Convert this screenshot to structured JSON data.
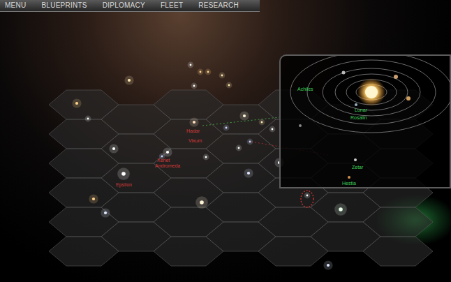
{
  "menu_bar": {
    "items": [
      "MENU",
      "BLUEPRINTS",
      "DIPLOMACY",
      "FLEET",
      "RESEARCH"
    ]
  },
  "galaxy_map": {
    "systems": [
      {
        "name": "Hadar"
      },
      {
        "name": "Vixum"
      },
      {
        "name": "Xeriet"
      },
      {
        "name": "Andromeda"
      },
      {
        "name": "Epsilon"
      }
    ]
  },
  "system_view": {
    "planets": [
      {
        "name": "Achiles"
      },
      {
        "name": "Lunar"
      },
      {
        "name": "Rosalin"
      },
      {
        "name": "Zetar"
      },
      {
        "name": "Hestia"
      }
    ]
  }
}
